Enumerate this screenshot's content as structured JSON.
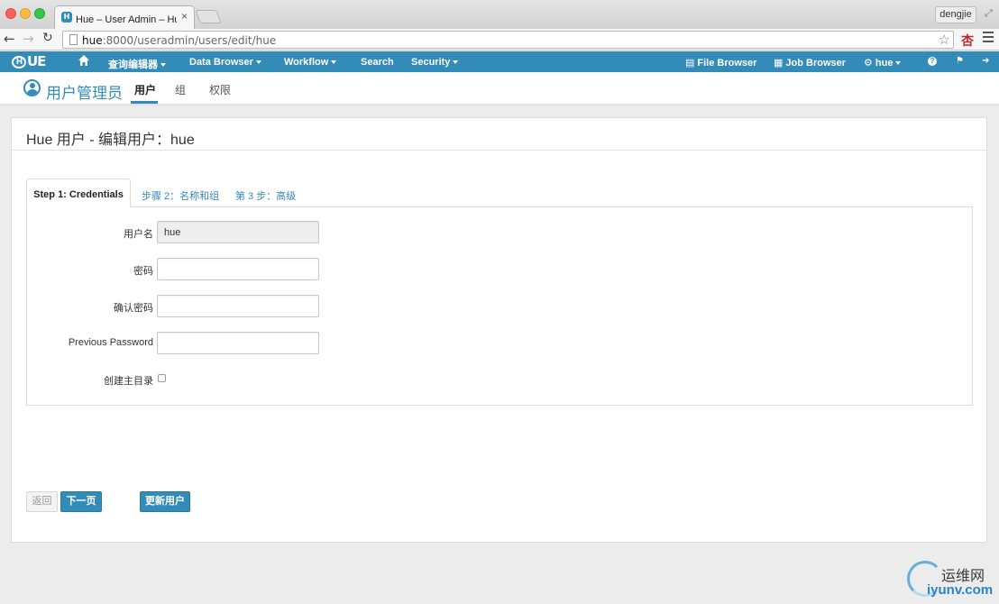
{
  "browser": {
    "tab_title": "Hue – User Admin – Hue 用",
    "tab_close": "×",
    "favicon": "H",
    "profile_name": "dengjie",
    "url_host": "hue",
    "url_rest": ":8000/useradmin/users/edit/hue",
    "icons": {
      "back": "arrow-left-icon",
      "forward": "arrow-right-icon",
      "reload": "reload-icon",
      "star": "star-icon",
      "menu": "hamburger-icon",
      "extension": "extension-icon"
    },
    "glyphs": {
      "back": "←",
      "forward": "→",
      "reload": "↻",
      "star": "☆",
      "extension": "杏",
      "fullscreen": "⤢"
    }
  },
  "hue_nav": {
    "logo": "UE",
    "logo_h": "H",
    "items": [
      {
        "label": "查询编辑器",
        "dropdown": true
      },
      {
        "label": "Data Browser",
        "dropdown": true
      },
      {
        "label": "Workflow",
        "dropdown": true
      },
      {
        "label": "Search",
        "dropdown": false
      },
      {
        "label": "Security",
        "dropdown": true
      }
    ],
    "file_browser": "File Browser",
    "job_browser": "Job Browser",
    "user_menu": "hue",
    "help_glyph": "?",
    "flag_glyph": "⚑",
    "logout_glyph": "➔",
    "file_glyph": "▤",
    "job_glyph": "▦",
    "gear_glyph": "⚙",
    "brand_color": "#338bb8"
  },
  "subnav": {
    "app_title": "用户管理员",
    "tabs": [
      {
        "label": "用户",
        "active": true
      },
      {
        "label": "组",
        "active": false
      },
      {
        "label": "权限",
        "active": false
      }
    ]
  },
  "card": {
    "title": "Hue 用户 - 编辑用户：hue",
    "steps": [
      {
        "label": "Step 1: Credentials",
        "active": true
      },
      {
        "label": "步骤 2：名称和组",
        "active": false
      },
      {
        "label": "第 3 步：高级",
        "active": false
      }
    ],
    "fields": {
      "username_label": "用户名",
      "username_value": "hue",
      "password_label": "密码",
      "password_value": "",
      "confirm_label": "确认密码",
      "confirm_value": "",
      "previous_label": "Previous Password",
      "previous_value": "",
      "homedir_label": "创建主目录",
      "homedir_checked": false
    },
    "buttons": {
      "back": "返回",
      "next": "下一页",
      "update": "更新用户"
    }
  },
  "watermark": {
    "cn": "运维网",
    "en": "iyunv.com"
  }
}
